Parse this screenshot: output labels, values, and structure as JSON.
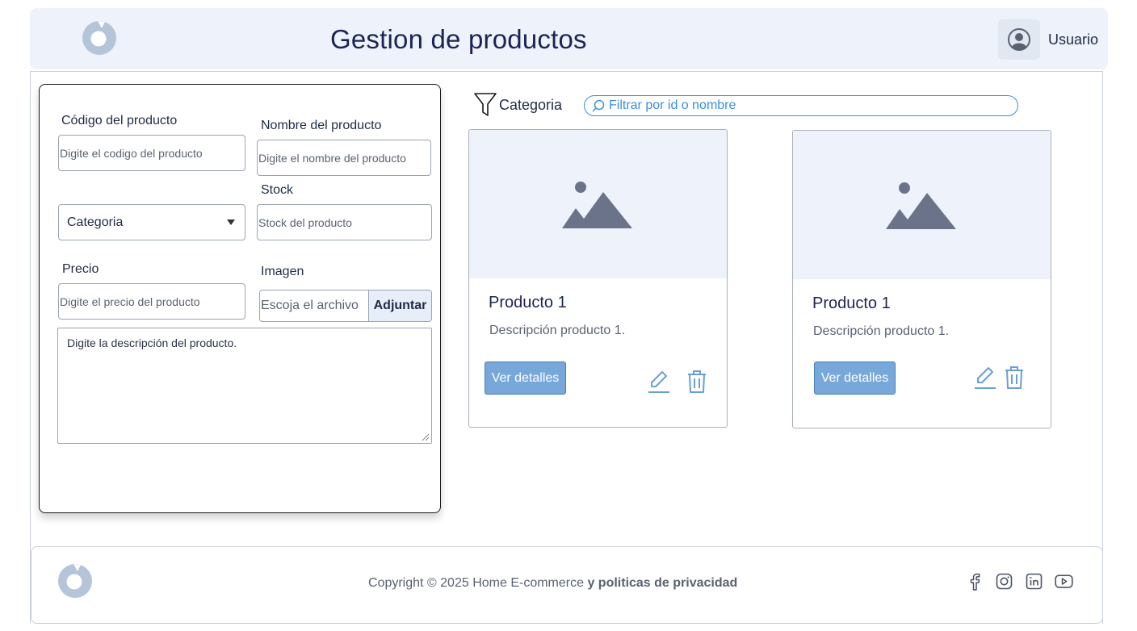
{
  "header": {
    "title": "Gestion de productos",
    "user_label": "Usuario"
  },
  "form": {
    "code_label": "Código del producto",
    "code_placeholder": "Digite el codigo del producto",
    "name_label": "Nombre del producto",
    "name_placeholder": "Digite el nombre del producto",
    "category_selected": "Categoria",
    "stock_label": "Stock",
    "stock_placeholder": "Stock del producto",
    "price_label": "Precio",
    "price_placeholder": "Digite el precio del producto",
    "image_label": "Imagen",
    "file_placeholder": "Escoja el archivo",
    "file_button": "Adjuntar",
    "description_placeholder": "Digite la descripción del producto."
  },
  "filter": {
    "category_label": "Categoria",
    "search_placeholder": "Filtrar por id o nombre"
  },
  "products": [
    {
      "title": "Producto 1",
      "description": "Descripción producto 1.",
      "details_label": "Ver detalles"
    },
    {
      "title": "Producto 1",
      "description": "Descripción producto 1.",
      "details_label": "Ver detalles"
    }
  ],
  "footer": {
    "copyright": "Copyright © 2025 Home E-commerce",
    "policy_link": "y politicas de privacidad",
    "socials": [
      "facebook-icon",
      "instagram-icon",
      "linkedin-icon",
      "youtube-icon"
    ]
  },
  "colors": {
    "header_bg": "#eef3fb",
    "title": "#1c2454",
    "accent_button": "#77a8d9",
    "search_accent": "#3a8ee0",
    "icon_blue": "#6a9fd3",
    "logo": "#b4c4d9"
  }
}
